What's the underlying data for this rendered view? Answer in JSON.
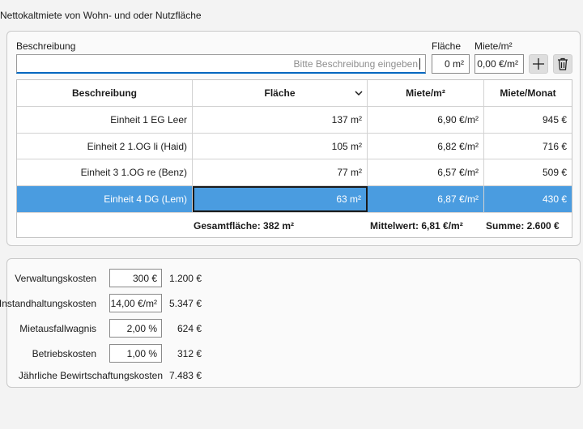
{
  "page_title": "Nettokaltmiete von Wohn- und oder Nutzfläche",
  "form": {
    "beschreibung_label": "Beschreibung",
    "beschreibung_placeholder": "Bitte Beschreibung eingeben",
    "flaeche_label": "Fläche",
    "flaeche_value": "0 m²",
    "miete_label": "Miete/m²",
    "miete_value": "0,00 €/m²",
    "add_icon": "plus-icon",
    "delete_icon": "trash-icon"
  },
  "table": {
    "columns": [
      "Beschreibung",
      "Fläche",
      "Miete/m²",
      "Miete/Monat"
    ],
    "rows": [
      [
        "Einheit 1 EG Leer",
        "137 m²",
        "6,90 €/m²",
        "945 €"
      ],
      [
        "Einheit 2 1.OG li (Haid)",
        "105 m²",
        "6,82 €/m²",
        "716 €"
      ],
      [
        "Einheit 3 1.OG re (Benz)",
        "77 m²",
        "6,57 €/m²",
        "509 €"
      ],
      [
        "Einheit 4 DG (Lem)",
        "63 m²",
        "6,87 €/m²",
        "430 €"
      ]
    ],
    "selected_row": 3,
    "footer": {
      "gesamtflaeche": "Gesamtfläche: 382 m²",
      "mittelwert": "Mittelwert: 6,81 €/m²",
      "summe": "Summe: 2.600 €"
    },
    "selection_color": "#4a9ce0"
  },
  "costs": {
    "items": [
      {
        "label": "Verwaltungskosten",
        "input": "300 €",
        "value": "1.200 €"
      },
      {
        "label": "Instandhaltungskosten",
        "input": "14,00 €/m²",
        "value": "5.347 €"
      },
      {
        "label": "Mietausfallwagnis",
        "input": "2,00 %",
        "value": "624 €"
      },
      {
        "label": "Betriebskosten",
        "input": "1,00 %",
        "value": "312 €"
      }
    ],
    "total_label": "Jährliche Bewirtschaftungskosten",
    "total_value": "7.483 €"
  }
}
